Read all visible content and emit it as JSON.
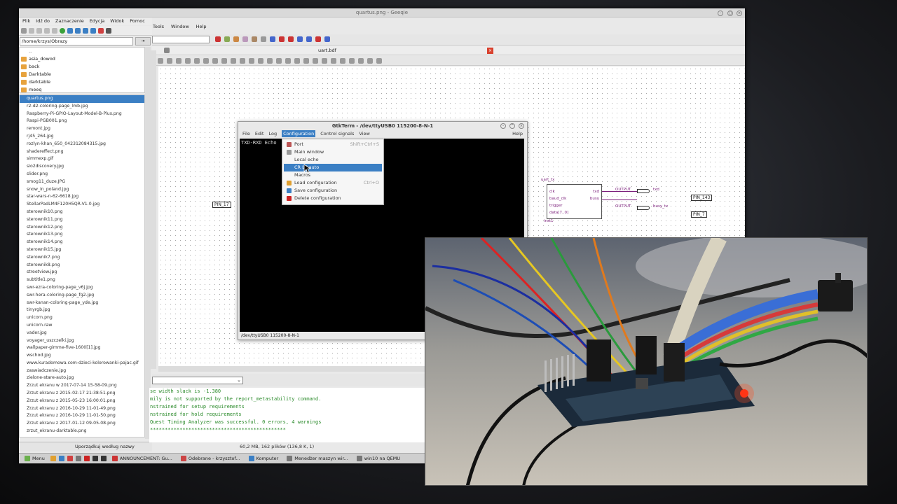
{
  "geeqie": {
    "title": "quartus.png - Geeqie",
    "menu": [
      "Plik",
      "Idź do",
      "Zaznaczenie",
      "Edycja",
      "Widok",
      "Pomoc"
    ],
    "path": "/home/krzys/Obrazy",
    "path_btn": "⇥",
    "folders": [
      "..",
      "asia_dowod",
      "back",
      "Darktable",
      "darktable",
      "meeq"
    ],
    "files": [
      "quartus.png",
      "r2-d2-coloring-page_lmb.jpg",
      "Raspberry-Pi-GPIO-Layout-Model-B-Plus.png",
      "Raspi-PGB001.png",
      "remont.jpg",
      "rj45_264.jpg",
      "rozlyn-khan_650_042312084315.jpg",
      "shadereffect.png",
      "simmexp.gif",
      "sio2discovery.jpg",
      "slider.png",
      "smog11_duze.JPG",
      "snow_in_poland.jpg",
      "star-wars-n-62-6618.jpg",
      "StellarPadLM4F120H5QR-V1.0.jpg",
      "sterownik10.png",
      "sterownik11.png",
      "sterownik12.png",
      "sterownik13.png",
      "sterownik14.png",
      "sterownik15.jpg",
      "sterownik7.png",
      "sterownik8.png",
      "streetview.jpg",
      "subtitle1.png",
      "swr-ezra-coloring-page_v6j.jpg",
      "swr-hera-coloring-page_fg2.jpg",
      "swr-kanan-coloring-page_yde.jpg",
      "tinyrgb.jpg",
      "unicorn.png",
      "unicorn.raw",
      "vader.jpg",
      "voyager_uszczelki.jpg",
      "wallpaper-gimme-five-1600[1].jpg",
      "wschod.jpg",
      "www.kuradomowa.com-dzieci-kolorowanki-pajac.gif",
      "zaswiadczenie.jpg",
      "zielone-stare-auto.jpg",
      "Zrzut ekranu w 2017-07-14 15-58-09.png",
      "Zrzut ekranu z 2015-02-17 21:38:51.png",
      "Zrzut ekranu z 2015-05-23 16:00:01.png",
      "Zrzut ekranu z 2016-10-29 11-01-49.png",
      "Zrzut ekranu z 2016-10-29 11-01-50.png",
      "Zrzut ekranu z 2017-01-12 09-05-08.png",
      "zrzut_ekranu-darktable.png"
    ],
    "sort_label": "Uporządkuj według nazwy",
    "status": "60,2 MB, 162 plików (136,8 K, 1)"
  },
  "quartus": {
    "menu": [
      "Tools",
      "Window",
      "Help"
    ],
    "tab": "uart.bdf",
    "console": [
      "se width slack is -1.380",
      "mily is not supported by the report_metastability command.",
      "nstrained for setup requirements",
      "nstrained for hold requirements",
      "Quest Timing Analyzer was successful. 0 errors, 4 warnings",
      "**********************************************"
    ],
    "schematic": {
      "pin17": "PIN_17",
      "instance": "uart_tx",
      "inst": "inst1",
      "ports_in": [
        "clk",
        "baud_clk",
        "trigger",
        "data[7..0]"
      ],
      "ports_out": [
        "txd",
        "busy"
      ],
      "out1": "OUTPUT",
      "out2": "OUTPUT",
      "sig1": "txd",
      "sig2": "busy_tx",
      "pin143": "PIN_143",
      "pin7": "PIN_7"
    }
  },
  "gtkterm": {
    "title": "GtkTerm - /dev/ttyUSB0  115200-8-N-1",
    "menu": [
      "File",
      "Edit",
      "Log",
      "Configuration",
      "Control signals",
      "View"
    ],
    "help": "Help",
    "terminal_text": "TXD-RXD Echo",
    "status": "/dev/ttyUSB0  115200-8-N-1",
    "dropdown": [
      {
        "label": "Port",
        "shortcut": "Shift+Ctrl+S"
      },
      {
        "label": "Main window",
        "shortcut": ""
      },
      {
        "label": "Local echo",
        "shortcut": ""
      },
      {
        "label": "CR LF auto",
        "shortcut": ""
      },
      {
        "label": "Macros",
        "shortcut": ""
      },
      {
        "label": "Load configuration",
        "shortcut": "Ctrl+O"
      },
      {
        "label": "Save configuration",
        "shortcut": ""
      },
      {
        "label": "Delete configuration",
        "shortcut": ""
      }
    ]
  },
  "taskbar": {
    "menu": "Menu",
    "items": [
      "ANNOUNCEMENT: Gu...",
      "Odebrane - krzysztof...",
      "Komputer",
      "Menedżer maszyn wir...",
      "win10 na QEMU"
    ]
  },
  "colors": {
    "selection": "#3b7fc4",
    "console_text": "#2a8a2a",
    "wire": "#7a1d7a",
    "close_red": "#d9412e"
  }
}
